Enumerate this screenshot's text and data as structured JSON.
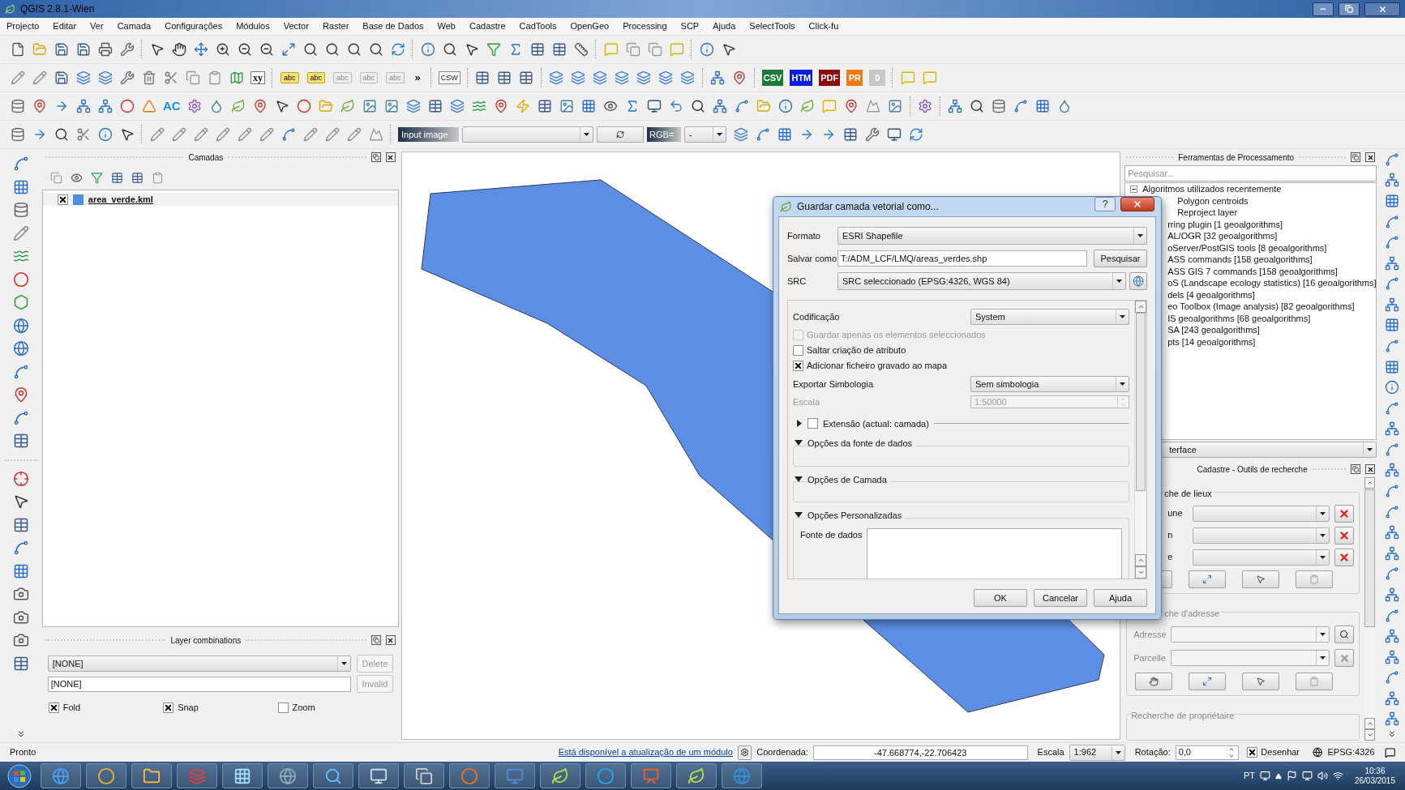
{
  "window": {
    "title": "QGIS 2.8.1-Wien"
  },
  "menu": [
    "Projecto",
    "Editar",
    "Ver",
    "Camada",
    "Configurações",
    "Módulos",
    "Vector",
    "Raster",
    "Base de Dados",
    "Web",
    "Cadastre",
    "CadTools",
    "OpenGeo",
    "Processing",
    "SCP",
    "Ajuda",
    "SelectTools",
    "Click-fu"
  ],
  "toolbars": {
    "xy": "xy",
    "label_tools": [
      {
        "text": "abc",
        "disabled": false
      },
      {
        "text": "abc",
        "disabled": false
      },
      {
        "text": "abc",
        "disabled": true
      },
      {
        "text": "abc",
        "disabled": true
      },
      {
        "text": "abc",
        "disabled": true
      }
    ],
    "overflow": "»",
    "csw": "CSW",
    "exports": [
      {
        "text": "CSV",
        "color": "#1a7a3a"
      },
      {
        "text": "HTM",
        "color": "#0a1ee0"
      },
      {
        "text": "PDF",
        "color": "#8a0a0a"
      },
      {
        "text": "PR",
        "color": "#f07a10"
      },
      {
        "text": "0",
        "color": "#c8c8c8"
      }
    ],
    "ac": "AC",
    "band_set": "Input image",
    "rgb_label": "RGB=",
    "rgb_value": "-"
  },
  "layers": {
    "title": "Camadas",
    "items": [
      {
        "name": "area_verde.kml",
        "checked": true,
        "color": "#4a8fe0"
      }
    ]
  },
  "layer_combinations": {
    "title": "Layer combinations",
    "combo": "[NONE]",
    "field": "[NONE]",
    "buttons": [
      {
        "label": "Delete",
        "disabled": true
      },
      {
        "label": "Invalid",
        "disabled": true
      }
    ],
    "options": [
      {
        "label": "Fold",
        "checked": true
      },
      {
        "label": "Snap",
        "checked": true
      },
      {
        "label": "Zoom",
        "checked": false
      }
    ]
  },
  "processing": {
    "title": "Ferramentas de Processamento",
    "search_placeholder": "Pesquisar...",
    "tree": [
      {
        "label": "Algoritmos utilizados recentemente",
        "expanded": true,
        "children": [
          {
            "label": "Polygon centroids"
          },
          {
            "label": "Reproject layer"
          }
        ]
      },
      {
        "label": "rring plugin [1 geoalgorithms]"
      },
      {
        "label": "AL/OGR [32 geoalgorithms]"
      },
      {
        "label": "oServer/PostGIS tools [8 geoalgorithms]"
      },
      {
        "label": "ASS commands [158 geoalgorithms]"
      },
      {
        "label": "ASS GIS 7 commands [158 geoalgorithms]"
      },
      {
        "label": "oS (Landscape ecology statistics) [16 geoalgorithms]"
      },
      {
        "label": "dels [4 geoalgorithms]"
      },
      {
        "label": "eo Toolbox (Image analysis) [82 geoalgorithms]"
      },
      {
        "label": "IS geoalgorithms [68 geoalgorithms]"
      },
      {
        "label": "SA [243 geoalgorithms]"
      },
      {
        "label": "pts [14 geoalgorithms]"
      }
    ],
    "mode": "terface"
  },
  "cadastre": {
    "title": "Cadastre - Outils de recherche",
    "place_group": {
      "title": "che de lieux",
      "fields": [
        "une",
        "n",
        "e"
      ]
    },
    "address_group": {
      "title": "che d'adresse",
      "fields": [
        "Adresse",
        "Parcelle"
      ]
    },
    "owner_group": {
      "title": "Recherche de propriétaire"
    }
  },
  "dialog": {
    "title": "Guardar camada vetorial como...",
    "help": "?",
    "format": {
      "label": "Formato",
      "value": "ESRI Shapefile"
    },
    "save_as": {
      "label": "Salvar como",
      "value": "T:/ADM_LCF/LMQ/areas_verdes.shp",
      "button": "Pesquisar"
    },
    "crs": {
      "label": "SRC",
      "value": "SRC seleccionado (EPSG:4326, WGS 84)"
    },
    "encoding": {
      "label": "Codificação",
      "value": "System"
    },
    "options": [
      {
        "label": "Guardar apenas os elementos seleccionados",
        "checked": false,
        "disabled": true
      },
      {
        "label": "Saltar criação de atributo",
        "checked": false,
        "disabled": false
      },
      {
        "label": "Adicionar ficheiro gravado ao mapa",
        "checked": true,
        "disabled": false
      }
    ],
    "symbology": {
      "label": "Exportar Simbologia",
      "value": "Sem simbologia"
    },
    "scale": {
      "label": "Escala",
      "value": "1:50000",
      "disabled": true
    },
    "extent": {
      "label": "Extensão (actual: camada)",
      "checked": false,
      "expanded": false
    },
    "groups": [
      {
        "title": "Opções da fonte de dados",
        "expanded": true
      },
      {
        "title": "Opções de Camada",
        "expanded": true
      },
      {
        "title": "Opções Personalizadas",
        "expanded": true,
        "field_label": "Fonte de dados"
      }
    ],
    "buttons": [
      "OK",
      "Cancelar",
      "Ajuda"
    ]
  },
  "status": {
    "state": "Pronto",
    "update_link": "Está disponível a atualização de um módulo",
    "coord_label": "Coordenada:",
    "coord": "-47.668774,-22.706423",
    "scale_label": "Escala",
    "scale": "1:962",
    "rotation_label": "Rotação:",
    "rotation": "0,0",
    "render": {
      "label": "Desenhar",
      "checked": true
    },
    "crs": "EPSG:4326"
  },
  "taskbar": {
    "language": "PT",
    "time": "10:36",
    "date": "26/03/2015"
  }
}
